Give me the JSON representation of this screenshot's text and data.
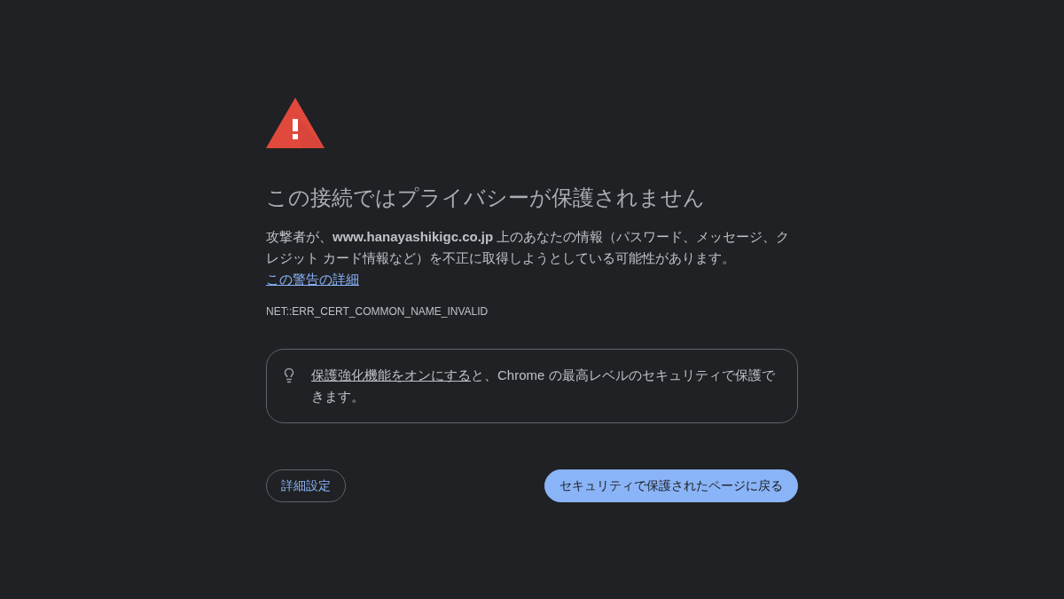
{
  "heading": "この接続ではプライバシーが保護されません",
  "message": {
    "text": "攻撃者が、**www.hanayashikigc.co.jp** 上のあなたの情報（パスワード、メッセージ、クレジット カード情報など）を不正に取得しようとしている可能性があります。",
    "link": "この警告の詳細"
  },
  "error_code": "NET::ERR_CERT_COMMON_NAME_INVALID",
  "tip": {
    "link": "保護強化機能をオンにする",
    "text": "と、Chrome の最高レベルのセキュリティで保護できます。"
  },
  "buttons": [
    {
      "kind": "secondary",
      "label": "詳細設定"
    },
    {
      "kind": "primary",
      "label": "セキュリティで保護されたページに戻る"
    }
  ]
}
